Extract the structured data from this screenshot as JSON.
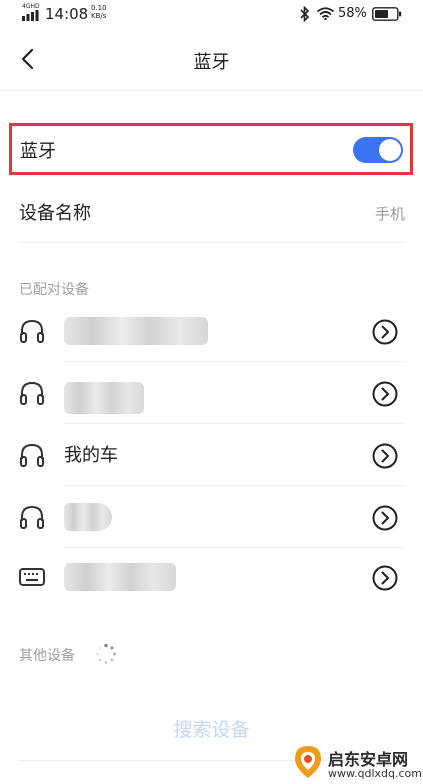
{
  "status_bar": {
    "network": "4GHD",
    "time": "14:08",
    "speed": "0.10 KB/s",
    "battery": "58%"
  },
  "nav": {
    "title": "蓝牙"
  },
  "bluetooth": {
    "label": "蓝牙",
    "enabled": true,
    "accent_color": "#3c73f0",
    "highlight_color": "#e0363f"
  },
  "device_name": {
    "label": "设备名称",
    "value": "手机"
  },
  "paired": {
    "section_label": "已配对设备",
    "devices": [
      {
        "icon": "headphones-icon",
        "name": ""
      },
      {
        "icon": "headphones-icon",
        "name": ""
      },
      {
        "icon": "headphones-icon",
        "name": "我的车"
      },
      {
        "icon": "headphones-icon",
        "name": ""
      },
      {
        "icon": "keyboard-icon",
        "name": ""
      }
    ]
  },
  "other": {
    "section_label": "其他设备"
  },
  "search": {
    "label": "搜索设备"
  },
  "watermark": {
    "title": "启东安卓网",
    "url": "www.qdlxdq.com"
  }
}
